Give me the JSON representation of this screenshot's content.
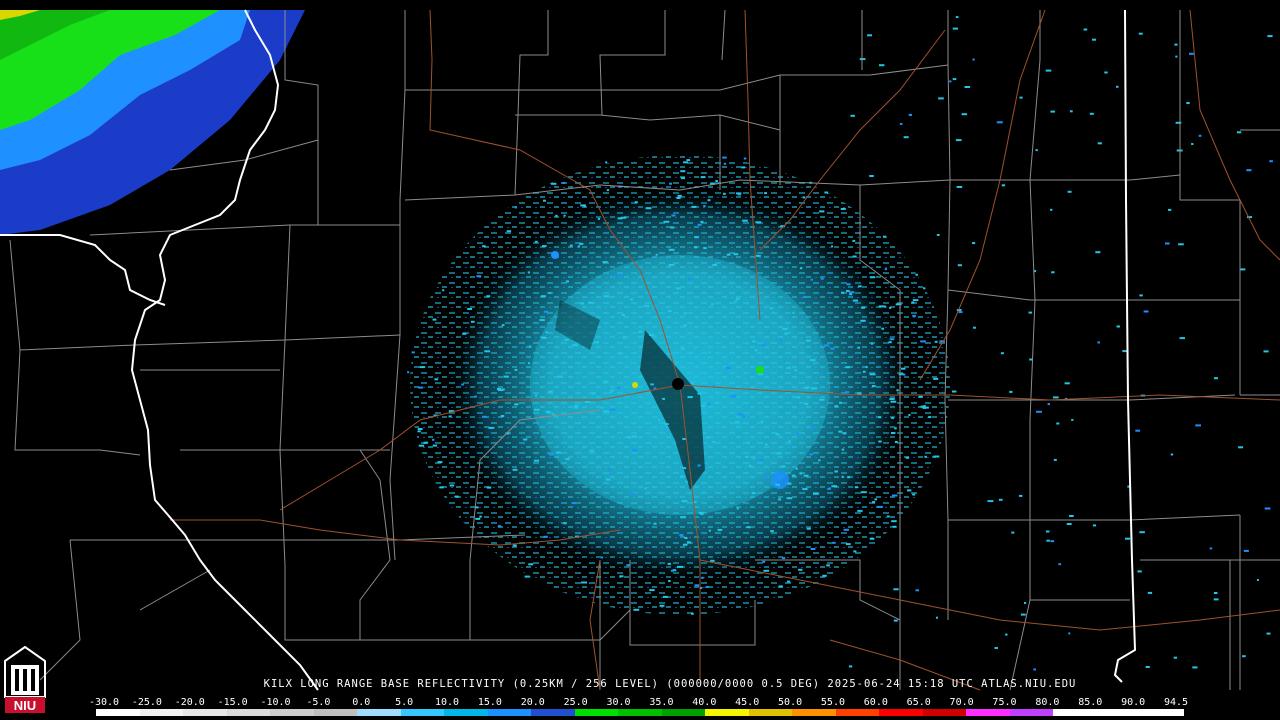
{
  "caption": "KILX LONG RANGE BASE REFLECTIVITY (0.25KM / 256 LEVEL) (000000/0000 0.5 DEG) 2025-06-24 15:18 UTC  ATLAS.NIU.EDU",
  "logo": {
    "text": "NIU",
    "color": "#c8102e"
  },
  "scale": {
    "labels": [
      "-30.0",
      "-25.0",
      "-20.0",
      "-15.0",
      "-10.0",
      "-5.0",
      "0.0",
      "5.0",
      "10.0",
      "15.0",
      "20.0",
      "25.0",
      "30.0",
      "35.0",
      "40.0",
      "45.0",
      "50.0",
      "55.0",
      "60.0",
      "65.0",
      "70.0",
      "75.0",
      "80.0",
      "85.0",
      "90.0",
      "94.5"
    ],
    "colors": [
      "#ffffff",
      "#f2f2f2",
      "#e6e6e6",
      "#d9d9d9",
      "#cccccc",
      "#bfbfbf",
      "#9fdcff",
      "#35c8ff",
      "#00b8e8",
      "#1e90ff",
      "#2050d0",
      "#00e000",
      "#00c000",
      "#00a000",
      "#f5f500",
      "#e0c000",
      "#ff9000",
      "#ff4000",
      "#ff0000",
      "#d00000",
      "#ff30ff",
      "#c040ff",
      "#ffffff",
      "#ffffff",
      "#ffffff"
    ]
  },
  "map": {
    "radar_site": {
      "name": "KILX"
    },
    "colors": {
      "county_line": "#8c8c8c",
      "state_line": "#ffffff",
      "road_line": "#a0522d",
      "echo_light": "#22c6e6",
      "echo_mid": "#1e90ff",
      "echo_dark": "#1a3cc8",
      "echo_green": "#18e018",
      "echo_yellow": "#d8d800"
    }
  }
}
